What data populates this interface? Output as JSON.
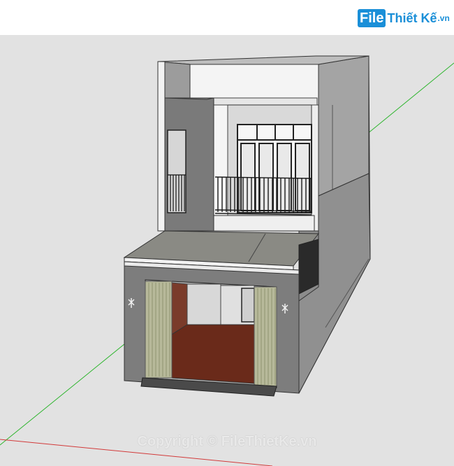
{
  "header": {
    "logo_file": "File",
    "logo_rest": "Thiết Kế",
    "logo_suffix": ".vn"
  },
  "footer": {
    "watermark": "Copyright © FileThietKe.vn"
  },
  "colors": {
    "background": "#e2e2e2",
    "brand": "#1a8fd8",
    "axis_green": "#2db52d",
    "axis_red": "#d23a3a"
  },
  "icons": [
    "filethietke-logo-icon",
    "axis-icon"
  ]
}
